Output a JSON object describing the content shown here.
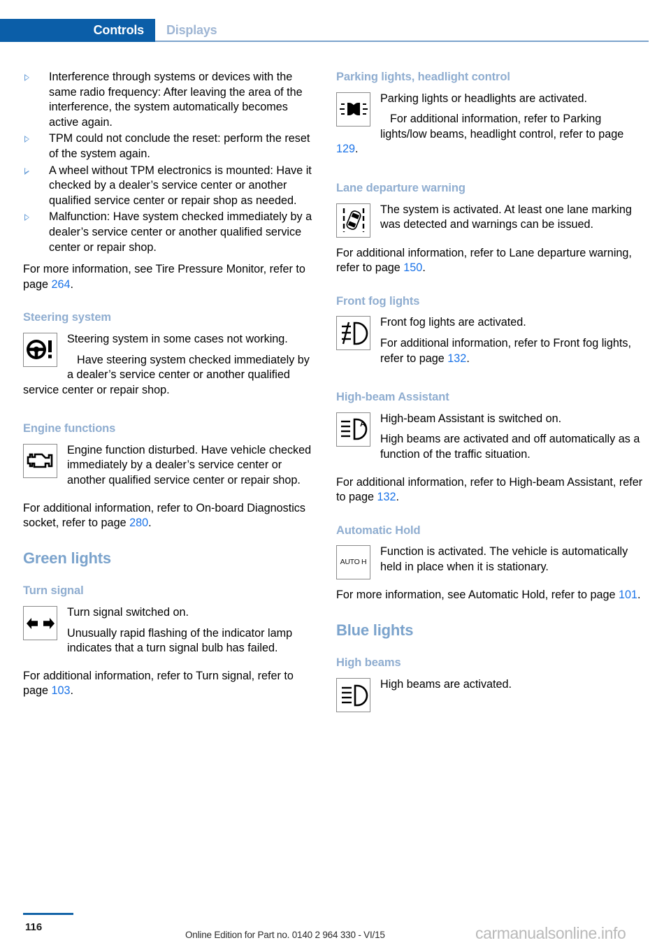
{
  "header": {
    "active_tab": "Controls",
    "inactive_tab": "Displays"
  },
  "colors": {
    "tab_active_bg": "#0b5ea8",
    "tab_inactive_text": "#9fb6d4",
    "section_heading": "#7ba3cc",
    "sub_heading": "#8fadd0",
    "page_ref_link": "#1a73e8",
    "bullet": "#6a9fd8",
    "footer_rule": "#1565a8",
    "watermark": "#b9b9b9"
  },
  "left_column": {
    "bullets": [
      "Interference through systems or devices with the same radio frequency: After leaving the area of the interference, the system automatically becomes active again.",
      "TPM could not conclude the reset: perform the reset of the system again.",
      "A wheel without TPM electronics is mounted: Have it checked by a dealer’s service center or another qualified service center or repair shop as needed.",
      "Malfunction: Have system checked immediately by a dealer’s service center or another qualified service center or repair shop."
    ],
    "tpm_note_before": "For more information, see Tire Pressure Monitor, refer to page ",
    "tpm_note_ref": "264",
    "tpm_note_after": ".",
    "steering": {
      "heading": "Steering system",
      "icon": "steering-wheel-warning-icon",
      "line1": "Steering system in some cases not working.",
      "line2": "Have steering system checked immediately by a dealer’s service center or another qualified service center or repair shop."
    },
    "engine": {
      "heading": "Engine functions",
      "icon": "check-engine-icon",
      "line1": "Engine function disturbed. Have vehicle checked immediately by a dealer’s service center or another qualified service center or repair shop.",
      "ref_before": "For additional information, refer to On-board Diagnostics socket, refer to page ",
      "ref": "280",
      "ref_after": "."
    },
    "green_lights_heading": "Green lights",
    "turn_signal": {
      "heading": "Turn signal",
      "icon": "turn-signal-arrows-icon",
      "line1": "Turn signal switched on.",
      "line2": "Unusually rapid flashing of the indicator lamp indicates that a turn signal bulb has failed.",
      "ref_before": "For additional information, refer to Turn signal, refer to page ",
      "ref": "103",
      "ref_after": "."
    }
  },
  "right_column": {
    "parking_lights": {
      "heading": "Parking lights, headlight control",
      "icon": "parking-lights-icon",
      "line1": "Parking lights or headlights are activated.",
      "line2_before": "For additional information, refer to Parking lights/low beams, headlight control, refer to page ",
      "line2_ref": "129",
      "line2_after": "."
    },
    "lane_departure": {
      "heading": "Lane departure warning",
      "icon": "lane-departure-warning-icon",
      "line1": "The system is activated. At least one lane marking was detected and warnings can be issued.",
      "ref_before": "For additional information, refer to Lane departure warning, refer to page ",
      "ref": "150",
      "ref_after": "."
    },
    "front_fog": {
      "heading": "Front fog lights",
      "icon": "front-fog-light-icon",
      "line1": "Front fog lights are activated.",
      "line2_before": "For additional information, refer to Front fog lights, refer to page ",
      "line2_ref": "132",
      "line2_after": "."
    },
    "high_beam_assistant": {
      "heading": "High-beam Assistant",
      "icon": "high-beam-assistant-icon",
      "line1": "High-beam Assistant is switched on.",
      "line2": "High beams are activated and off automatically as a function of the traffic situation.",
      "ref_before": "For additional information, refer to High-beam Assistant, refer to page ",
      "ref": "132",
      "ref_after": "."
    },
    "automatic_hold": {
      "heading": "Automatic Hold",
      "icon": "auto-hold-icon",
      "icon_text": "AUTO H",
      "line1": "Function is activated. The vehicle is automatically held in place when it is stationary.",
      "ref_before": "For more information, see Automatic Hold, refer to page ",
      "ref": "101",
      "ref_after": "."
    },
    "blue_lights_heading": "Blue lights",
    "high_beams": {
      "heading": "High beams",
      "icon": "high-beam-icon",
      "line1": "High beams are activated."
    }
  },
  "footer": {
    "page_number": "116",
    "edition": "Online Edition for Part no. 0140 2 964 330 - VI/15",
    "watermark": "carmanualsonline.info"
  }
}
